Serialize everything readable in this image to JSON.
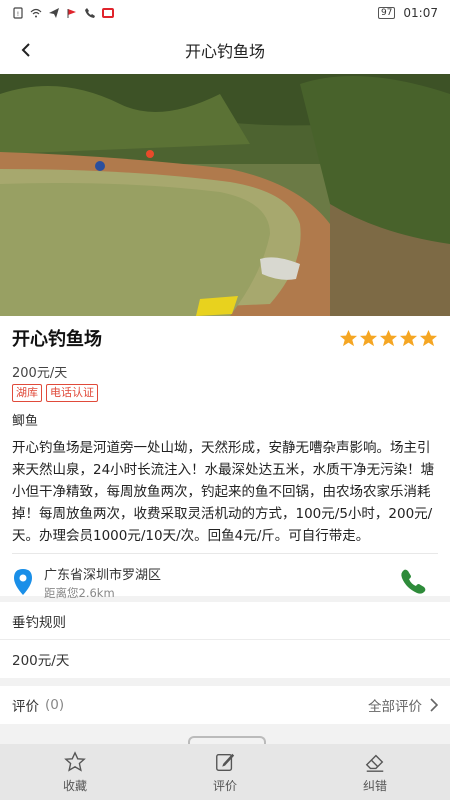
{
  "status_bar": {
    "battery": "97",
    "time": "01:07"
  },
  "nav": {
    "title": "开心钓鱼场"
  },
  "spot": {
    "name": "开心钓鱼场",
    "rating": 5,
    "price": "200元/天",
    "tags": [
      "湖库",
      "电话认证"
    ],
    "fish": "鲫鱼",
    "description": "开心钓鱼场是河道旁一处山坳，天然形成，安静无嘈杂声影响。场主引来天然山泉，24小时长流注入！水最深处达五米，水质干净无污染！塘小但干净精致，每周放鱼两次，钓起来的鱼不回锅，由农场农家乐消耗掉！每周放鱼两次，收费采取灵活机动的方式，100元/5小时，200元/天。办理会员1000元/10天/次。回鱼4元/斤。可自行带走。",
    "address": "广东省深圳市罗湖区",
    "distance": "距离您2.6km"
  },
  "rules": {
    "title": "垂钓规则",
    "value": "200元/天"
  },
  "review": {
    "label": "评价",
    "count": "(0)",
    "all_label": "全部评价"
  },
  "bottom_bar": {
    "favorite": "收藏",
    "comment": "评价",
    "report": "纠错"
  },
  "colors": {
    "star": "#f5a623",
    "tag": "#e04a3a",
    "pin": "#1a8fe8",
    "phone": "#2e8b3a"
  }
}
